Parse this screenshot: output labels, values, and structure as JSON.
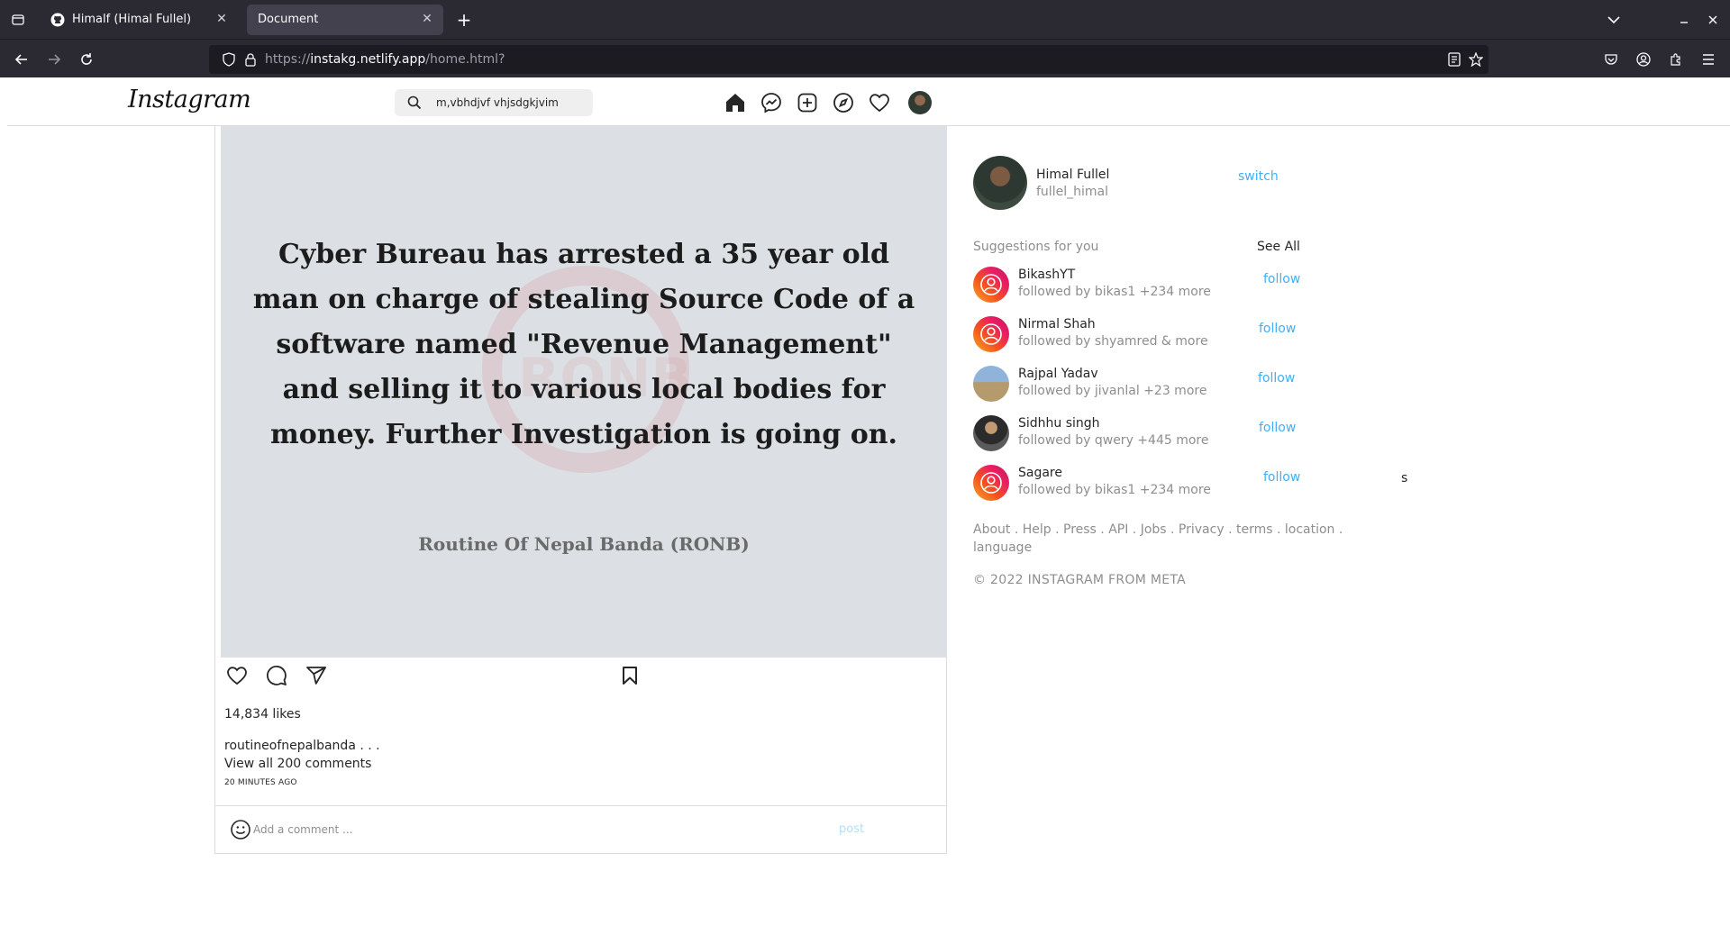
{
  "browser": {
    "tabs": [
      {
        "title": "Himalf (Himal Fullel)"
      },
      {
        "title": "Document"
      }
    ],
    "url": {
      "scheme": "https://",
      "host": "instakg.netlify.app",
      "path": "/home.html?"
    }
  },
  "header": {
    "logo": "Instagram",
    "search_value": "m,vbhdjvf vhjsdgkjvim"
  },
  "post": {
    "headline": "Cyber Bureau has arrested a 35 year old man on charge of stealing Source Code of a software named \"Revenue Management\" and selling it to various local bodies for money. Further Investigation is going on.",
    "credit": "Routine Of Nepal Banda (RONB)",
    "likes": "14,834 likes",
    "username": "routineofnepalbanda . . .",
    "view_comments": "View all 200 comments",
    "time": "20 MINUTES AGO",
    "comment_placeholder": "Add a comment ...",
    "post_label": "post"
  },
  "sidebar": {
    "profile": {
      "name": "Himal Fullel",
      "username": "fullel_himal",
      "switch_label": "switch"
    },
    "suggestions_title": "Suggestions for you",
    "see_all": "See All",
    "suggestions": [
      {
        "name": "BikashYT",
        "sub": "followed by bikas1 +234 more",
        "action": "follow"
      },
      {
        "name": "Nirmal Shah",
        "sub": "followed by shyamred & more",
        "action": "follow"
      },
      {
        "name": "Rajpal Yadav",
        "sub": "followed by jivanlal +23 more",
        "action": "follow"
      },
      {
        "name": "Sidhhu singh",
        "sub": "followed by qwery +445 more",
        "action": "follow"
      },
      {
        "name": "Sagare",
        "sub": "followed by bikas1 +234 more",
        "action": "follow"
      }
    ],
    "stray_text": "s",
    "footer_links": "About . Help . Press . API . Jobs . Privacy . terms . location . language",
    "copyright": "© 2022 INSTAGRAM FROM META"
  }
}
